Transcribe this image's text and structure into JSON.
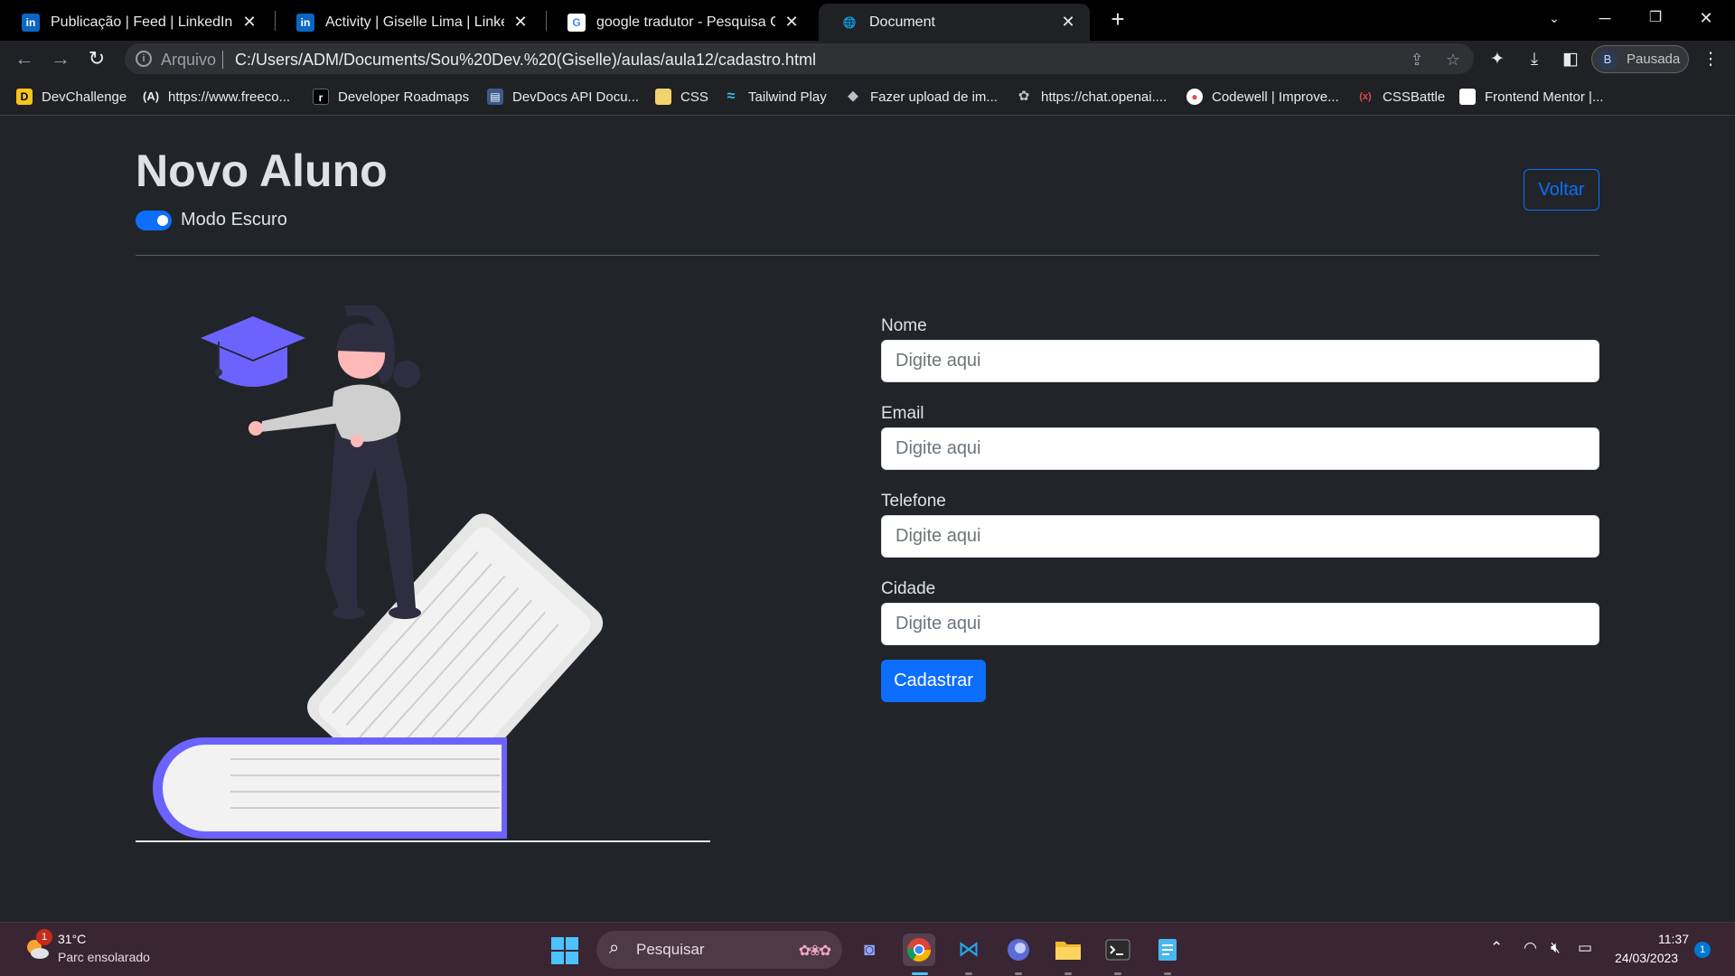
{
  "browser": {
    "tabs": [
      {
        "title": "Publicação | Feed | LinkedIn",
        "icon": "linkedin-icon"
      },
      {
        "title": "Activity | Giselle Lima | LinkedIn",
        "icon": "linkedin-icon"
      },
      {
        "title": "google tradutor - Pesquisa Google",
        "icon": "google-icon"
      },
      {
        "title": "Document",
        "icon": "globe-icon",
        "active": true
      }
    ],
    "address": {
      "scheme_label": "Arquivo",
      "url": "C:/Users/ADM/Documents/Sou%20Dev.%20(Giselle)/aulas/aula12/cadastro.html"
    },
    "profile": {
      "initial": "B",
      "label": "Pausada"
    },
    "bookmarks": [
      {
        "label": "DevChallenge",
        "icon": "devchallenge-icon"
      },
      {
        "label": "https://www.freeco...",
        "icon": "freecodecamp-icon"
      },
      {
        "label": "Developer Roadmaps",
        "icon": "roadmap-icon"
      },
      {
        "label": "DevDocs API Docu...",
        "icon": "devdocs-icon"
      },
      {
        "label": "CSS",
        "icon": "folder-icon"
      },
      {
        "label": "Tailwind Play",
        "icon": "tailwind-icon"
      },
      {
        "label": "Fazer upload de im...",
        "icon": "upload-icon"
      },
      {
        "label": "https://chat.openai....",
        "icon": "openai-icon"
      },
      {
        "label": "Codewell | Improve...",
        "icon": "codewell-icon"
      },
      {
        "label": "CSSBattle",
        "icon": "cssbattle-icon"
      },
      {
        "label": "Frontend Mentor |...",
        "icon": "frontend-mentor-icon"
      }
    ]
  },
  "page": {
    "title": "Novo Aluno",
    "dark_mode": {
      "label": "Modo Escuro",
      "checked": true
    },
    "back_button": "Voltar",
    "form": {
      "fields": [
        {
          "label": "Nome",
          "placeholder": "Digite aqui"
        },
        {
          "label": "Email",
          "placeholder": "Digite aqui"
        },
        {
          "label": "Telefone",
          "placeholder": "Digite aqui"
        },
        {
          "label": "Cidade",
          "placeholder": "Digite aqui"
        }
      ],
      "submit": "Cadastrar"
    },
    "colors": {
      "accent": "#0d6efd",
      "background": "#212529",
      "illustration_accent": "#6c63ff"
    }
  },
  "taskbar": {
    "weather": {
      "temp": "31°C",
      "desc": "Parc ensolarado",
      "badge": "1"
    },
    "search_placeholder": "Pesquisar",
    "apps": [
      "discord-icon",
      "chrome-icon",
      "vscode-icon",
      "firefox-dev-icon",
      "file-explorer-icon",
      "terminal-icon",
      "notepad-icon"
    ],
    "clock": {
      "time": "11:37",
      "date": "24/03/2023"
    },
    "notifications": "1"
  }
}
